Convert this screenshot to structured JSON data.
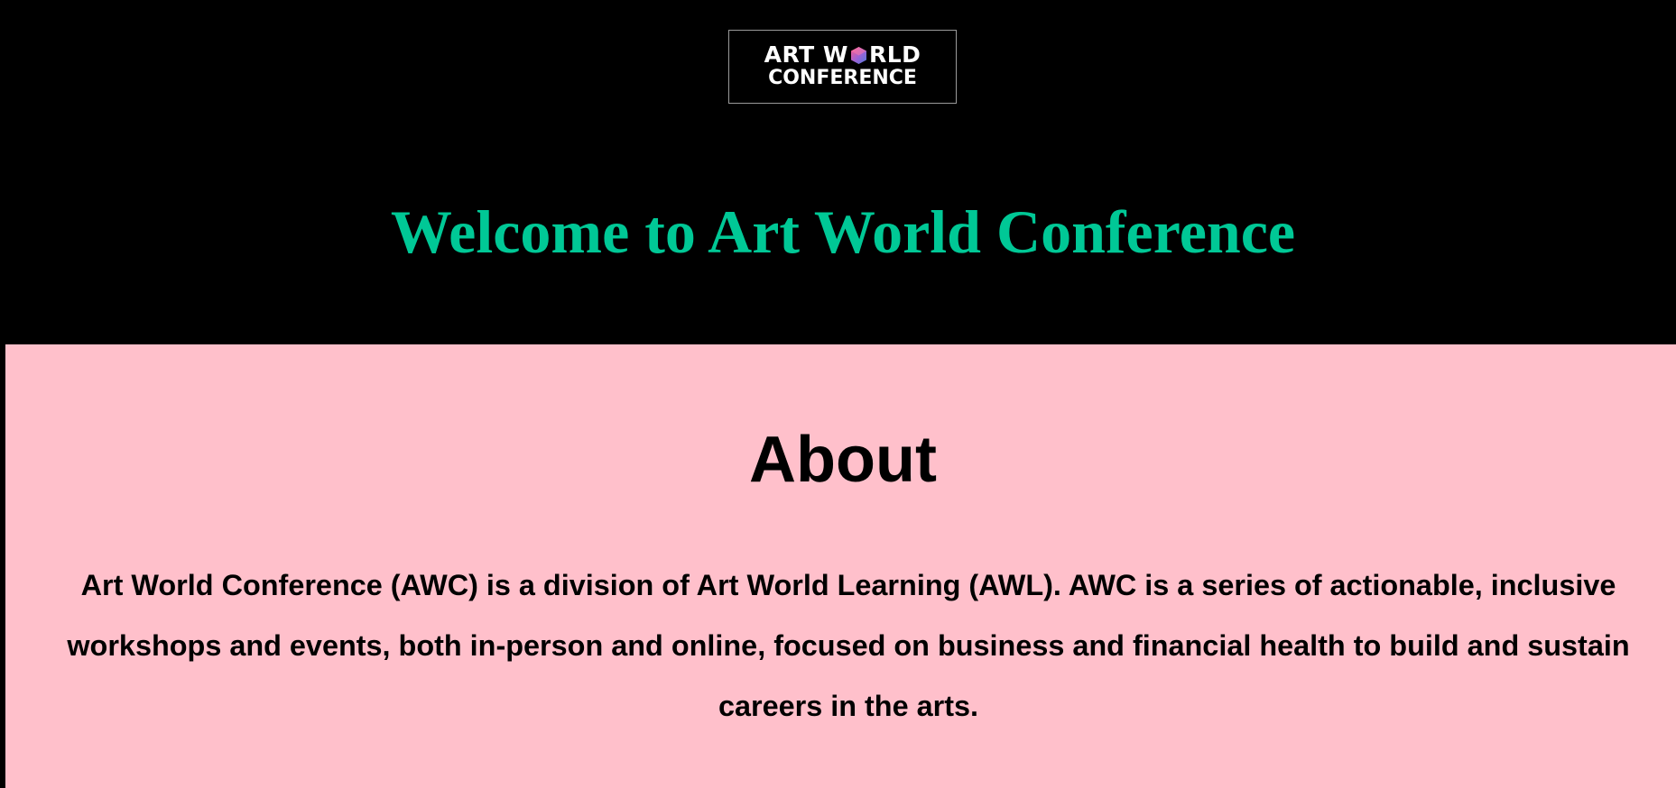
{
  "colors": {
    "header_background": "#000000",
    "welcome_color": "#00c896",
    "about_background": "#ffc0cb",
    "text_color": "#000000"
  },
  "header": {
    "logo": {
      "line1_before": "ART W",
      "line1_after": "RLD",
      "line2": "CONFERENCE",
      "gem_icon": "hexagon-gem-icon"
    },
    "welcome_title": "Welcome to Art World Conference"
  },
  "about": {
    "title": "About",
    "text": "Art World Conference (AWC) is a division of Art World Learning (AWL). AWC is a series of actionable, inclusive workshops and events, both in-person and online, focused on business and financial health to build and sustain careers in the arts."
  }
}
